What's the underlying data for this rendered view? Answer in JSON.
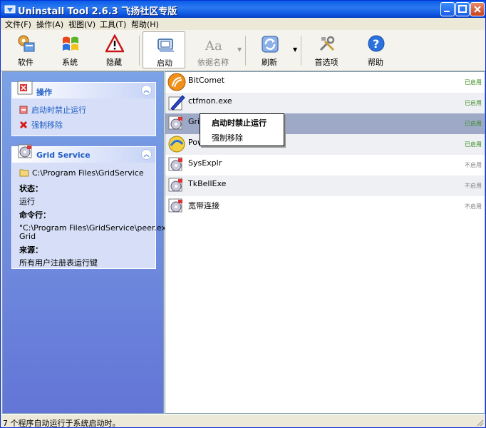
{
  "window": {
    "title": "Uninstall Tool 2.6.3 飞扬社区专版"
  },
  "menu": [
    "文件(F)",
    "操作(A)",
    "视图(V)",
    "工具(T)",
    "帮助(H)"
  ],
  "toolbar": {
    "software": "软件",
    "system": "系统",
    "hidden": "隐藏",
    "startup": "启动",
    "sort_by_name": "依据名称",
    "refresh": "刷新",
    "preferences": "首选项",
    "help": "帮助"
  },
  "actions_panel": {
    "title": "操作",
    "disable_startup": "启动时禁止运行",
    "force_remove": "强制移除"
  },
  "details_panel": {
    "title": "Grid Service",
    "path": "C:\\Program Files\\GridService",
    "status_label": "状态：",
    "status_value": "运行",
    "cmd_label": "命令行：",
    "cmd_line1": "\"C:\\Program Files\\GridService\\peer.exe\" -n",
    "cmd_line2": "Grid",
    "source_label": "来源：",
    "source_value": "所有用户注册表运行键"
  },
  "list": [
    {
      "name": "BitComet",
      "status": "已启用",
      "enabled": true
    },
    {
      "name": "ctfmon.exe",
      "status": "已启用",
      "enabled": true
    },
    {
      "name": "Grid Service",
      "status": "已启用",
      "enabled": true
    },
    {
      "name": "Power",
      "status": "已启用",
      "enabled": true
    },
    {
      "name": "SysExplr",
      "status": "不启用",
      "enabled": false
    },
    {
      "name": "TkBellExe",
      "status": "不启用",
      "enabled": false
    },
    {
      "name": "宽带连接",
      "status": "不启用",
      "enabled": false
    }
  ],
  "context_menu": {
    "disable_startup": "启动时禁止运行",
    "force_remove": "强制移除"
  },
  "statusbar": {
    "text": "7 个程序自动运行于系统启动时。"
  },
  "colors": {
    "accent": "#215dc6",
    "titlebar": "#0a5de8",
    "selection": "#9ea9c8",
    "enabled": "#3a8a20"
  }
}
